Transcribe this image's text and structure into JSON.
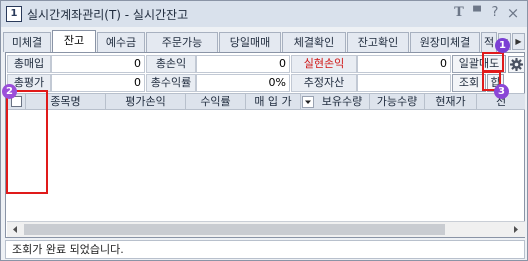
{
  "window": {
    "app_icon_text": "1",
    "title": "실시간계좌관리(T) - 실시간잔고",
    "title_buttons": [
      "T",
      "▀",
      "?",
      "×"
    ]
  },
  "tabs": [
    "미체결",
    "잔고",
    "예수금",
    "주문가능",
    "당일매매",
    "체결확인",
    "잔고확인",
    "원장미체결",
    "적"
  ],
  "active_tab": "잔고",
  "summary": {
    "total_buy_label": "총매입",
    "total_buy_value": "0",
    "total_pl_label": "총손익",
    "total_pl_value": "0",
    "realized_pl_label": "실현손익",
    "realized_pl_value": "0",
    "bulk_sell_button": "일괄매도",
    "total_eval_label": "총평가",
    "total_eval_value": "0",
    "total_return_label": "총수익률",
    "total_return_value": "0%",
    "est_asset_label": "추정자산",
    "est_asset_value": "",
    "query_button": "조회",
    "sum_button": "합"
  },
  "grid": {
    "columns": [
      "종목명",
      "평가손익",
      "수익률",
      "매 입 가",
      "보유수량",
      "가능수량",
      "현재가",
      "전"
    ]
  },
  "status": "조회가 완료 되었습니다.",
  "annotations": [
    "1",
    "2",
    "3"
  ],
  "colors": {
    "highlight": "#e01a1a",
    "badge_1": "#7b3fd4",
    "badge_2": "#9b4fd9",
    "badge_3": "#8a47d6",
    "realized_label": "#d01515"
  },
  "icons": {
    "settings": "gear-icon",
    "tab_scroll_left": "chevron-left-icon",
    "tab_scroll_right": "chevron-right-icon",
    "dropdown": "chevron-down-icon"
  }
}
